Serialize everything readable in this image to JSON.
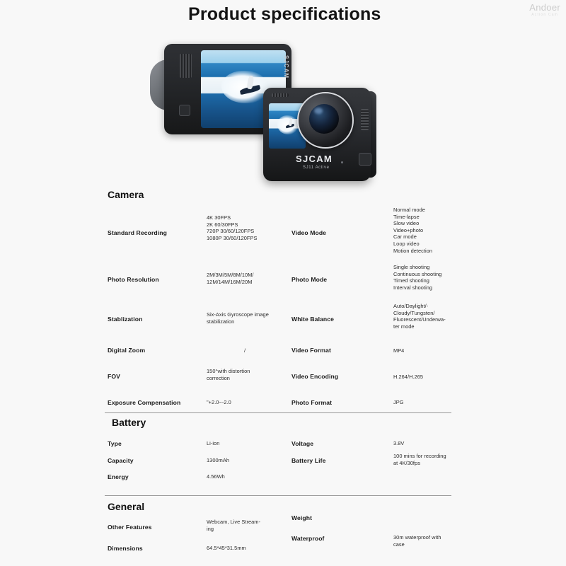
{
  "header": {
    "title": "Product specifications",
    "watermark_main": "Andoer",
    "watermark_sub": "Action Cam"
  },
  "product_images": {
    "rear_camera_brand": "SJCAM",
    "front_camera_brand": "SJCAM",
    "front_camera_model": "SJ11 Active"
  },
  "sections": [
    {
      "title": "Camera",
      "rows": [
        {
          "left_label": "Standard Recording",
          "left_value": "4K 30FPS\n2K 60/30FPS\n720P 30/60/120FPS\n1080P 30/60/120FPS",
          "right_label": "Video Mode",
          "right_value": "Normal mode\nTime-lapse\nSlow video\nVideo+photo\nCar mode\nLoop video\nMotion detection"
        },
        {
          "left_label": "Photo Resolution",
          "left_value": "2M/3M/5M/8M/10M/\n12M/14M/16M/20M",
          "right_label": "Photo Mode",
          "right_value": "Single shooting\nContinuous shooting\nTimed shooting\nInterval shooting"
        },
        {
          "left_label": "Stablization",
          "left_value": "Six-Axis Gyroscope image\nstabilization",
          "right_label": "White Balance",
          "right_value": "Auto/Daylight/-\nCloudy/Tungsten/\nFluorescent/Underwa-\nter mode"
        },
        {
          "left_label": "Digital Zoom",
          "left_value": "/",
          "right_label": "Video Format",
          "right_value": "MP4"
        },
        {
          "left_label": "FOV",
          "left_value": "150°with distortion\ncorrection",
          "right_label": "Video Encoding",
          "right_value": "H.264/H.265"
        },
        {
          "left_label": "Exposure Compensation",
          "left_value": "\"+2.0~-2.0",
          "right_label": "Photo Format",
          "right_value": "JPG"
        }
      ]
    },
    {
      "title": "Battery",
      "rows": [
        {
          "left_label": "Type",
          "left_value": "Li-ion",
          "right_label": "Voltage",
          "right_value": "3.8V"
        },
        {
          "left_label": "Capacity",
          "left_value": "1300mAh",
          "right_label": "Battery Life",
          "right_value": "100 mins for recording\nat 4K/30fps"
        },
        {
          "left_label": "Energy",
          "left_value": "4.56Wh",
          "right_label": "",
          "right_value": ""
        }
      ]
    },
    {
      "title": "General",
      "rows": [
        {
          "left_label": "Other Features",
          "left_value": "Webcam, Live Stream-\ning",
          "right_label": "Weight",
          "right_value": ""
        },
        {
          "left_label": "Dimensions",
          "left_value": "64.5*45*31.5mm",
          "right_label": "Waterproof",
          "right_value": "30m waterproof with\ncase"
        }
      ]
    }
  ]
}
